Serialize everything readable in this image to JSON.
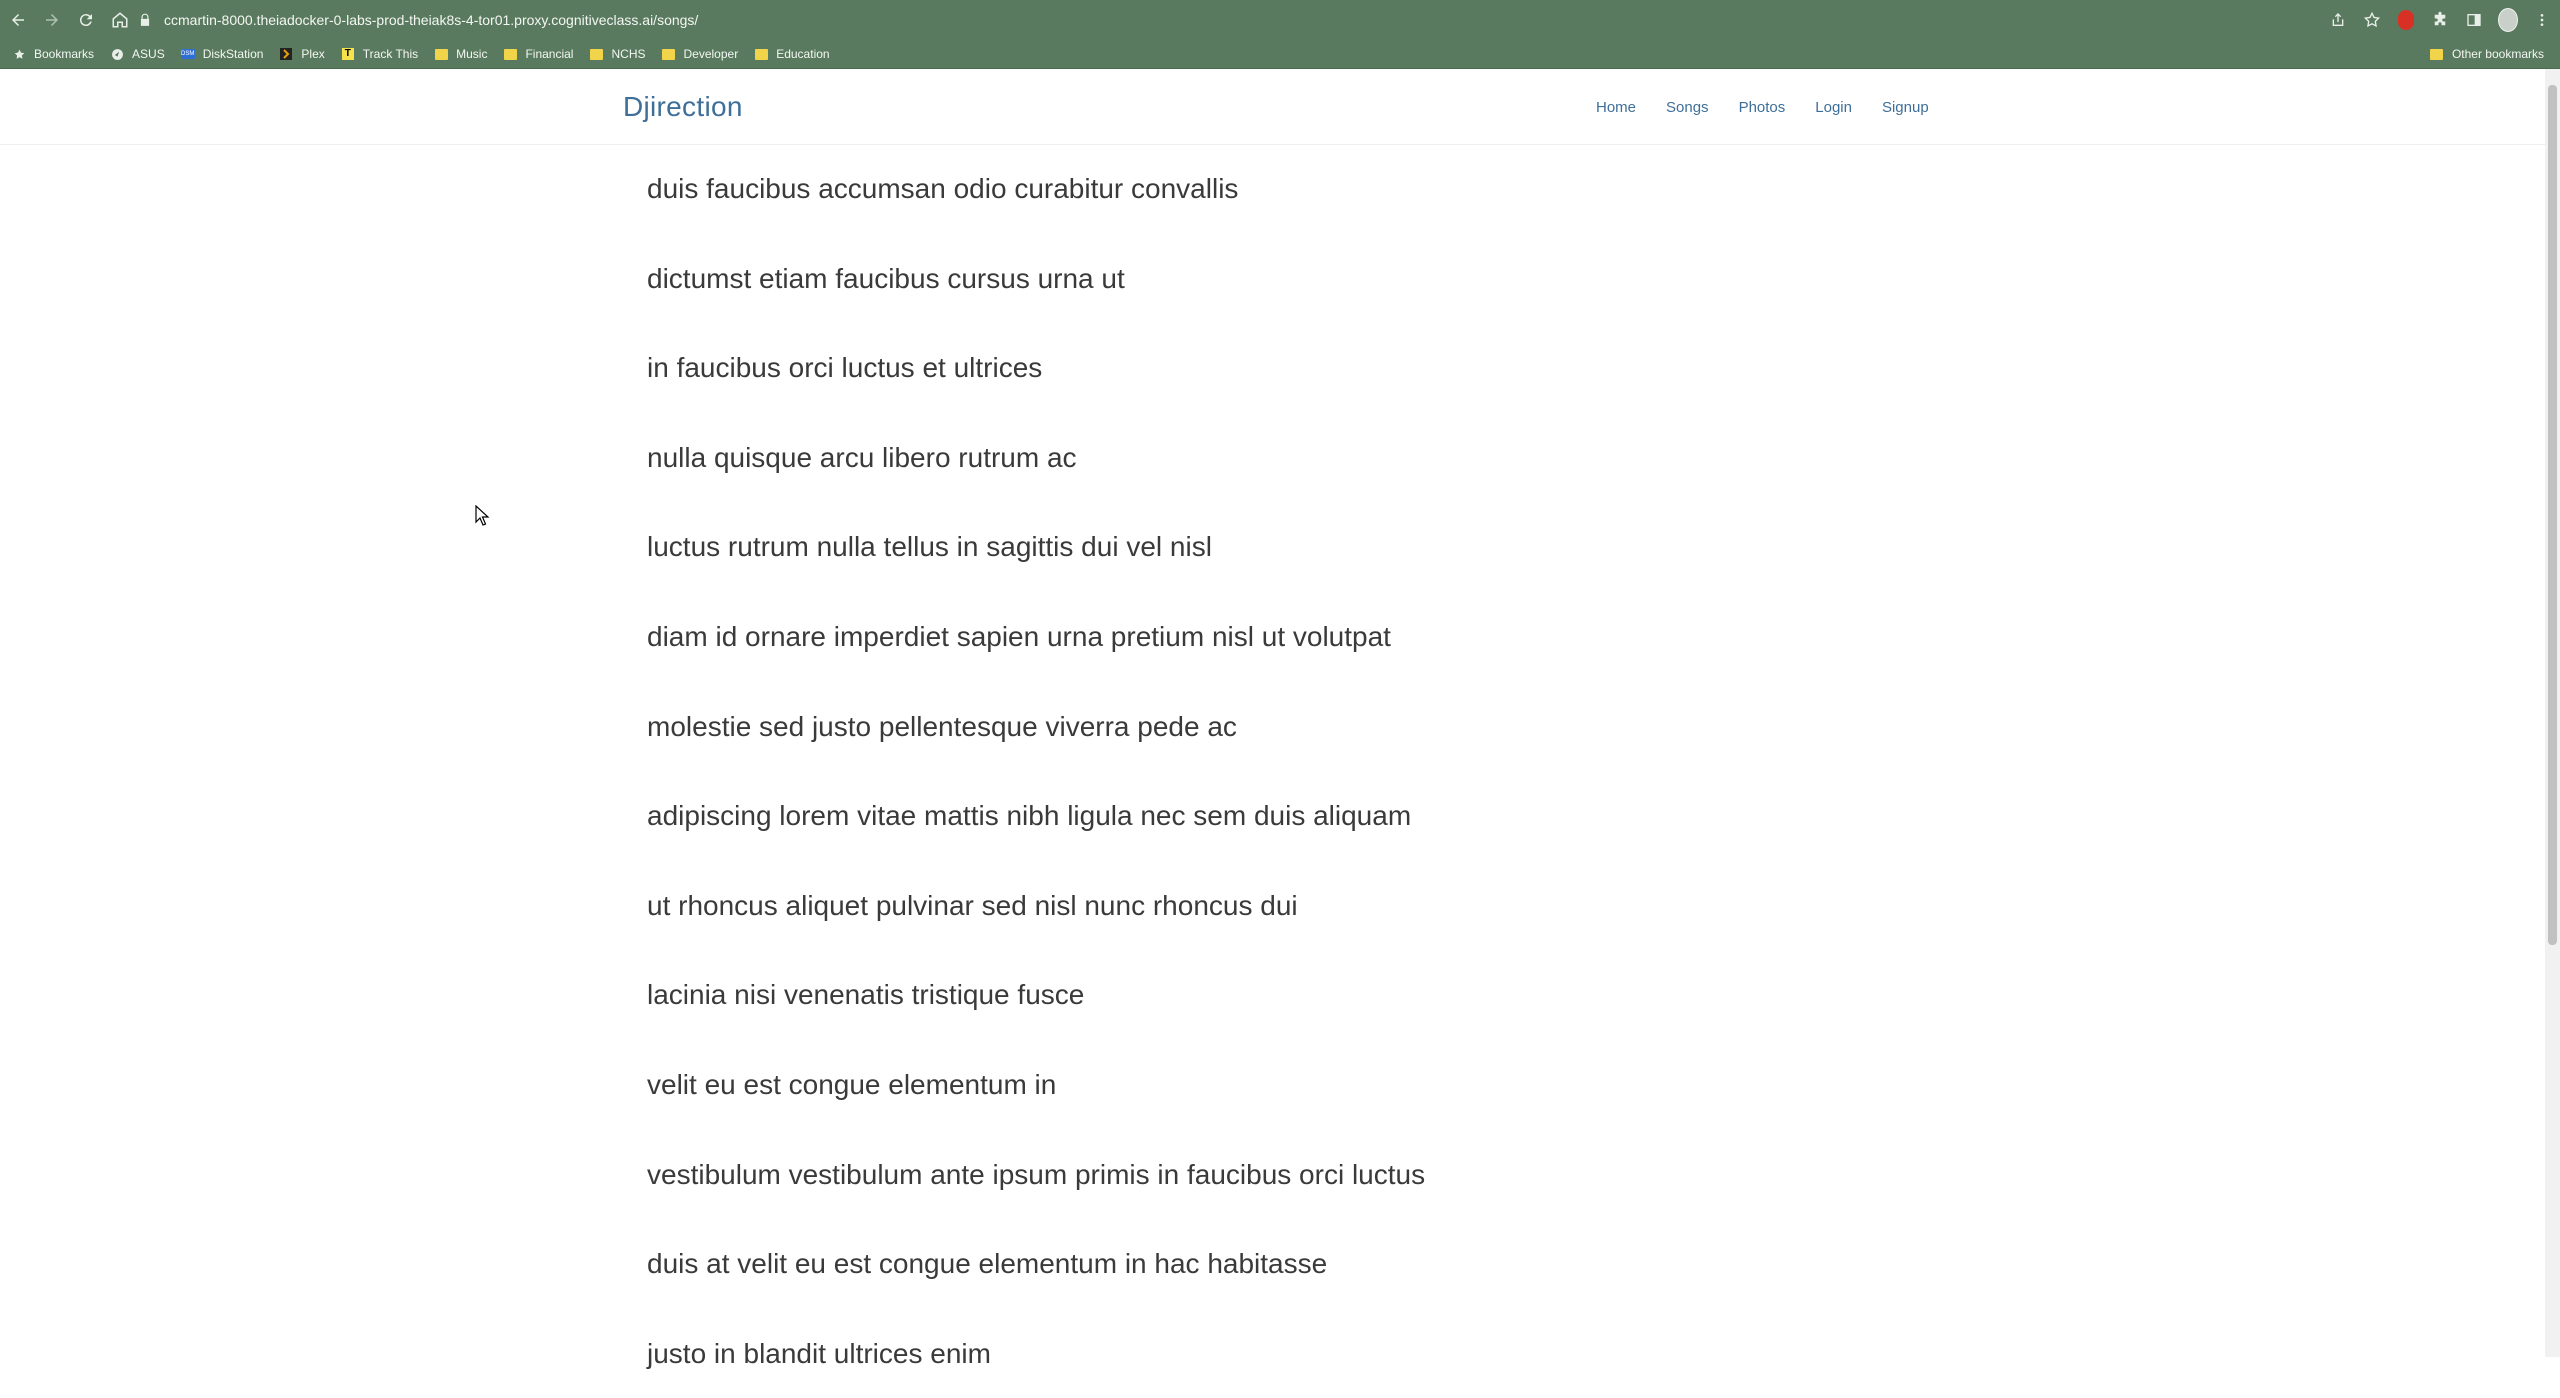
{
  "browser": {
    "url": "ccmartin-8000.theiadocker-0-labs-prod-theiak8s-4-tor01.proxy.cognitiveclass.ai/songs/",
    "bookmarks": [
      {
        "label": "Bookmarks",
        "icon": "star-icon"
      },
      {
        "label": "ASUS",
        "icon": "asus-icon"
      },
      {
        "label": "DiskStation",
        "icon": "dsm-icon"
      },
      {
        "label": "Plex",
        "icon": "plex-icon"
      },
      {
        "label": "Track This",
        "icon": "track-icon"
      },
      {
        "label": "Music",
        "icon": "folder-icon"
      },
      {
        "label": "Financial",
        "icon": "folder-icon"
      },
      {
        "label": "NCHS",
        "icon": "folder-icon"
      },
      {
        "label": "Developer",
        "icon": "folder-icon"
      },
      {
        "label": "Education",
        "icon": "folder-icon"
      }
    ],
    "other_bookmarks": "Other bookmarks"
  },
  "site": {
    "brand": "Djirection",
    "nav": [
      {
        "label": "Home"
      },
      {
        "label": "Songs"
      },
      {
        "label": "Photos"
      },
      {
        "label": "Login"
      },
      {
        "label": "Signup"
      }
    ]
  },
  "songs": [
    "duis faucibus accumsan odio curabitur convallis",
    "dictumst etiam faucibus cursus urna ut",
    "in faucibus orci luctus et ultrices",
    "nulla quisque arcu libero rutrum ac",
    "luctus rutrum nulla tellus in sagittis dui vel nisl",
    "diam id ornare imperdiet sapien urna pretium nisl ut volutpat",
    "molestie sed justo pellentesque viverra pede ac",
    "adipiscing lorem vitae mattis nibh ligula nec sem duis aliquam",
    "ut rhoncus aliquet pulvinar sed nisl nunc rhoncus dui",
    "lacinia nisi venenatis tristique fusce",
    "velit eu est congue elementum in",
    "vestibulum vestibulum ante ipsum primis in faucibus orci luctus",
    "duis at velit eu est congue elementum in hac habitasse",
    "justo in blandit ultrices enim"
  ],
  "colors": {
    "chrome": "#5a7a5f",
    "brand": "#3f6f99",
    "text": "#3a3a3a"
  }
}
